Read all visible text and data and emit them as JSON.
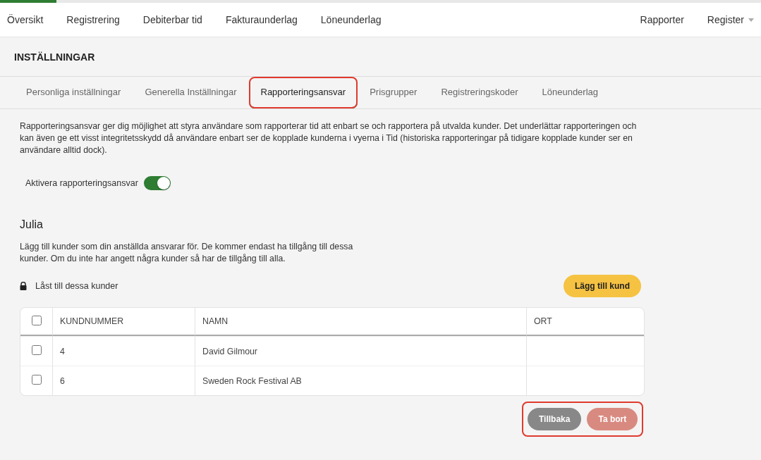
{
  "nav": {
    "left": [
      "Översikt",
      "Registrering",
      "Debiterbar tid",
      "Fakturaunderlag",
      "Löneunderlag"
    ],
    "right": [
      {
        "label": "Rapporter",
        "dropdown": false
      },
      {
        "label": "Register",
        "dropdown": true
      }
    ]
  },
  "page_title": "INSTÄLLNINGAR",
  "tabs": [
    {
      "label": "Personliga inställningar",
      "selected": false,
      "highlighted": false
    },
    {
      "label": "Generella Inställningar",
      "selected": false,
      "highlighted": false
    },
    {
      "label": "Rapporteringsansvar",
      "selected": true,
      "highlighted": true
    },
    {
      "label": "Prisgrupper",
      "selected": false,
      "highlighted": false
    },
    {
      "label": "Registreringskoder",
      "selected": false,
      "highlighted": false
    },
    {
      "label": "Löneunderlag",
      "selected": false,
      "highlighted": false
    }
  ],
  "intro": "Rapporteringsansvar ger dig möjlighet att styra användare som rapporterar tid att enbart se och rapportera på utvalda kunder. Det underlättar rapporteringen och kan även ge ett visst integritetsskydd då användare enbart ser de kopplade kunderna i vyerna i Tid (historiska rapporteringar på tidigare kopplade kunder ser en användare alltid dock).",
  "toggle": {
    "label": "Aktivera rapporteringsansvar",
    "on": true
  },
  "user": {
    "name": "Julia",
    "description": "Lägg till kunder som din anställda ansvarar för. De kommer endast ha tillgång till dessa kunder. Om du inte har angett några kunder så har de tillgång till alla.",
    "lock_label": "Låst till dessa kunder",
    "add_button": "Lägg till kund"
  },
  "table": {
    "all_checked": false,
    "columns": [
      "KUNDNUMMER",
      "NAMN",
      "ORT"
    ],
    "rows": [
      {
        "checked": false,
        "cells": [
          "4",
          "David Gilmour"
        ]
      },
      {
        "checked": false,
        "cells": [
          "6",
          "Sweden Rock Festival AB"
        ]
      }
    ]
  },
  "actions": {
    "highlighted": true,
    "buttons": [
      {
        "label": "Tillbaka",
        "disabled": false
      },
      {
        "label": "Ta bort",
        "disabled": true
      }
    ]
  }
}
